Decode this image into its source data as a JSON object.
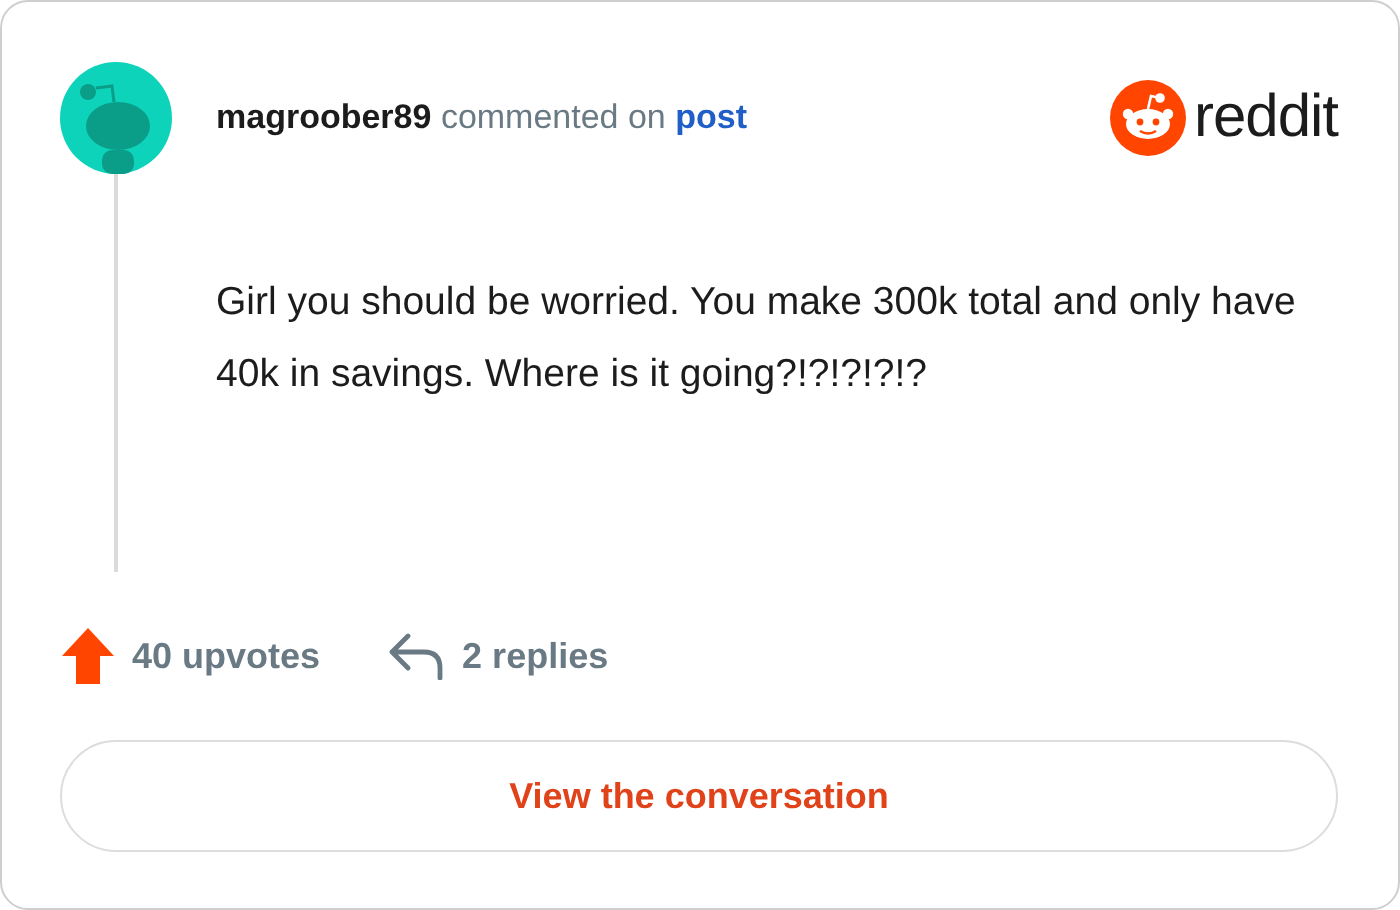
{
  "comment": {
    "author": "magroober89",
    "action": "commented on",
    "link": "post",
    "body": "Girl you should be worried. You make 300k total and only have 40k in savings. Where is it going?!?!?!?!?"
  },
  "brand": {
    "wordmark": "reddit"
  },
  "stats": {
    "upvotes": "40 upvotes",
    "replies": "2 replies"
  },
  "button": {
    "label": "View the conversation"
  }
}
